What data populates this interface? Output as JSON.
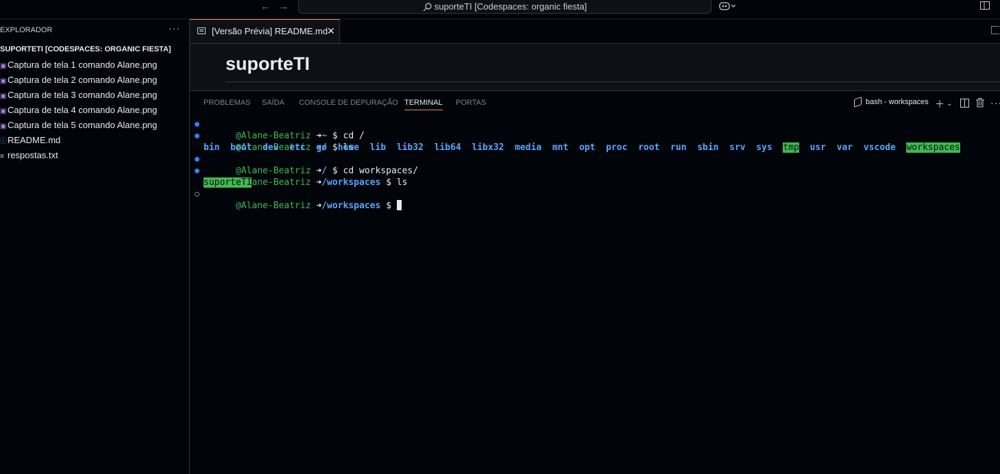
{
  "titlebar": {
    "search_text": "suporteTI [Codespaces: organic fiesta]",
    "back_icon": "arrow-left-icon",
    "forward_icon": "arrow-right-icon"
  },
  "sidebar": {
    "header": "EXPLORADOR",
    "more": "···",
    "folder": "SUPORTETI [CODESPACES: ORGANIC FIESTA]",
    "files": [
      {
        "name": "Captura de tela 1 comando Alane.png",
        "type": "png"
      },
      {
        "name": "Captura de tela 2 comando Alane.png",
        "type": "png"
      },
      {
        "name": "Captura de tela 3 comando Alane.png",
        "type": "png"
      },
      {
        "name": "Captura de tela 4 comando Alane.png",
        "type": "png"
      },
      {
        "name": "Captura de tela 5 comando Alane.png",
        "type": "png"
      },
      {
        "name": "README.md",
        "type": "md"
      },
      {
        "name": "respostas.txt",
        "type": "txt"
      }
    ]
  },
  "editor": {
    "tab_label": "[Versão Prévia] README.md",
    "close": "✕",
    "heading": "suporteTI"
  },
  "panel": {
    "tabs": [
      "PROBLEMAS",
      "SAÍDA",
      "CONSOLE DE DEPURAÇÃO",
      "TERMINAL",
      "PORTAS"
    ],
    "active_tab": "TERMINAL",
    "terminal_name": "bash - workspaces"
  },
  "terminal": {
    "user": "@Alane-Beatriz",
    "arrow": "➜",
    "line1": {
      "path": "~",
      "cmd": "$ cd /"
    },
    "line2": {
      "path": "/",
      "cmd": "$ ls"
    },
    "ls_root": [
      "bin",
      "boot",
      "dev",
      "etc",
      "go",
      "home",
      "lib",
      "lib32",
      "lib64",
      "libx32",
      "media",
      "mnt",
      "opt",
      "proc",
      "root",
      "run",
      "sbin",
      "srv",
      "sys",
      "tmp",
      "usr",
      "var",
      "vscode",
      "workspaces"
    ],
    "line4": {
      "path": "/",
      "cmd": "$ cd workspaces/"
    },
    "line5": {
      "path": "/workspaces",
      "cmd": "$ ls"
    },
    "ls_workspaces": "suporteTI",
    "line7": {
      "path": "/workspaces",
      "cmd": "$ "
    }
  },
  "colors": {
    "accent": "#f78166",
    "user_green": "#3fb950",
    "path_blue": "#58a6ff"
  }
}
